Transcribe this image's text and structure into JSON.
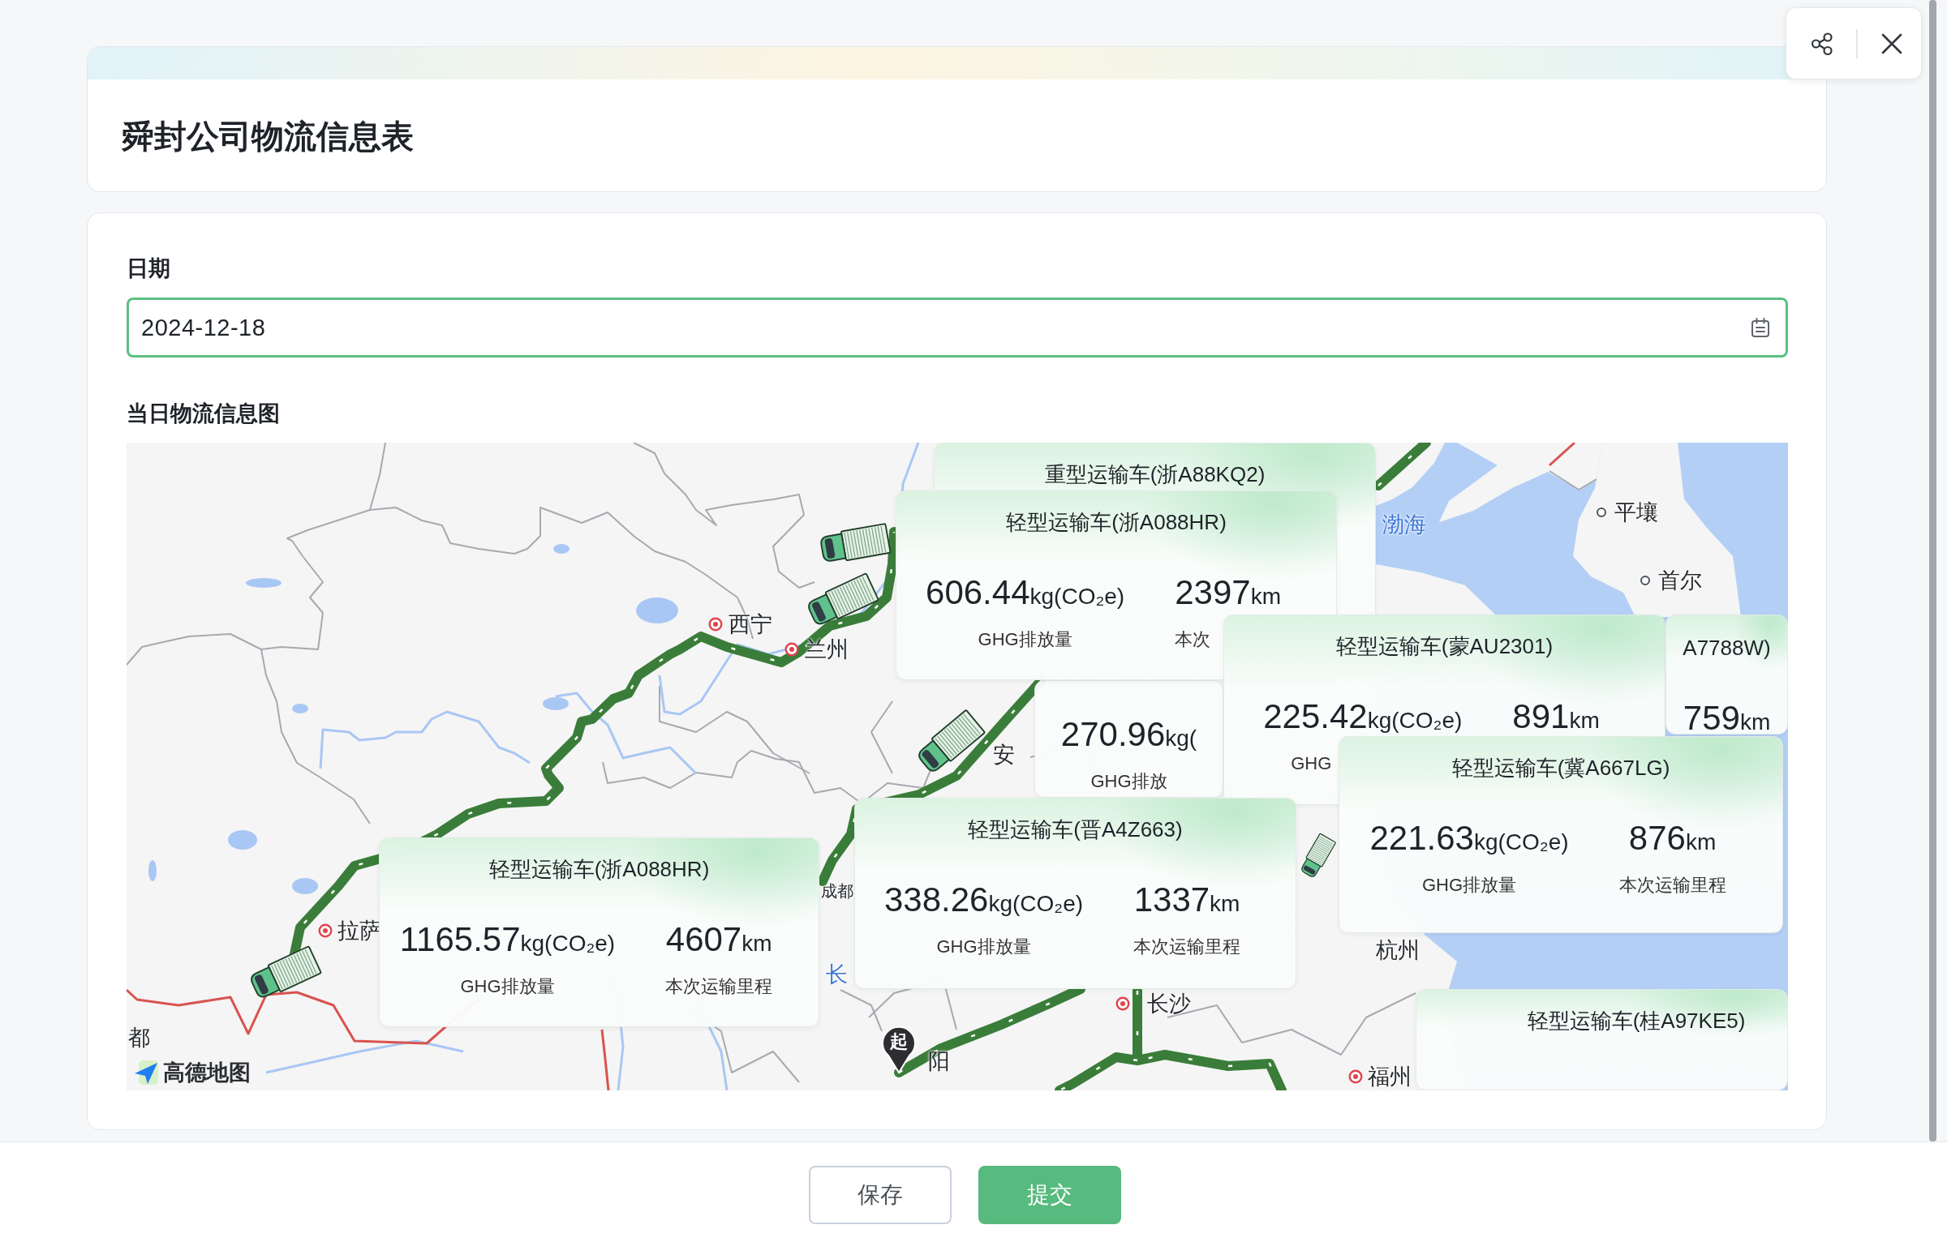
{
  "header": {
    "title": "舜封公司物流信息表"
  },
  "form": {
    "date": {
      "label": "日期",
      "value": "2024-12-18"
    },
    "map_section": {
      "label": "当日物流信息图",
      "vehicle_cards": [
        {
          "title": "重型运输车(浙A88KQ2)"
        },
        {
          "title": "轻型运输车(浙A088HR)",
          "emission": "606.44",
          "emission_unit": "kg(CO₂e)",
          "emission_label": "GHG排放量",
          "distance": "2397",
          "distance_unit": "km",
          "distance_label": "本次"
        },
        {
          "title": "轻型运输车(蒙AU2301)",
          "emission": "225.42",
          "emission_unit": "kg(CO₂e)",
          "emission_label": "GHG",
          "distance": "891",
          "distance_unit": "km"
        },
        {
          "title": "A7788W)",
          "distance": "759",
          "distance_unit": "km"
        },
        {
          "emission": "270.96",
          "emission_unit": "kg(",
          "emission_label": "GHG排放"
        },
        {
          "title": "轻型运输车(冀A667LG)",
          "emission": "221.63",
          "emission_unit": "kg(CO₂e)",
          "emission_label": "GHG排放量",
          "distance": "876",
          "distance_unit": "km",
          "distance_label": "本次运输里程"
        },
        {
          "title": "轻型运输车(晋A4Z663)",
          "emission": "338.26",
          "emission_unit": "kg(CO₂e)",
          "emission_label": "GHG排放量",
          "distance": "1337",
          "distance_unit": "km",
          "distance_label": "本次运输里程"
        },
        {
          "title": "轻型运输车(浙A088HR)",
          "emission": "1165.57",
          "emission_unit": "kg(CO₂e)",
          "emission_label": "GHG排放量",
          "distance": "4607",
          "distance_unit": "km",
          "distance_label": "本次运输里程"
        },
        {
          "title": "轻型运输车(桂A97KE5)"
        }
      ],
      "place_labels": [
        {
          "text": "平壤",
          "kind": "foreign"
        },
        {
          "text": "渤海",
          "kind": "water"
        },
        {
          "text": "首尔",
          "kind": "foreign"
        },
        {
          "text": "西宁",
          "kind": "city"
        },
        {
          "text": "兰州",
          "kind": "city"
        },
        {
          "text": "安",
          "kind": "plain"
        },
        {
          "text": "成都",
          "kind": "plain"
        },
        {
          "text": "拉萨",
          "kind": "city"
        },
        {
          "text": "杭州",
          "kind": "plain"
        },
        {
          "text": "长",
          "kind": "water"
        },
        {
          "text": "长沙",
          "kind": "city"
        },
        {
          "text": "都",
          "kind": "plain"
        },
        {
          "text": "阳",
          "kind": "plain"
        },
        {
          "text": "福州",
          "kind": "city"
        }
      ],
      "start_markers": [
        {
          "text": "起"
        }
      ],
      "logo": {
        "text": "高德地图"
      }
    }
  },
  "actions": [
    {
      "label": "保存",
      "kind": "secondary"
    },
    {
      "label": "提交",
      "kind": "primary"
    }
  ]
}
